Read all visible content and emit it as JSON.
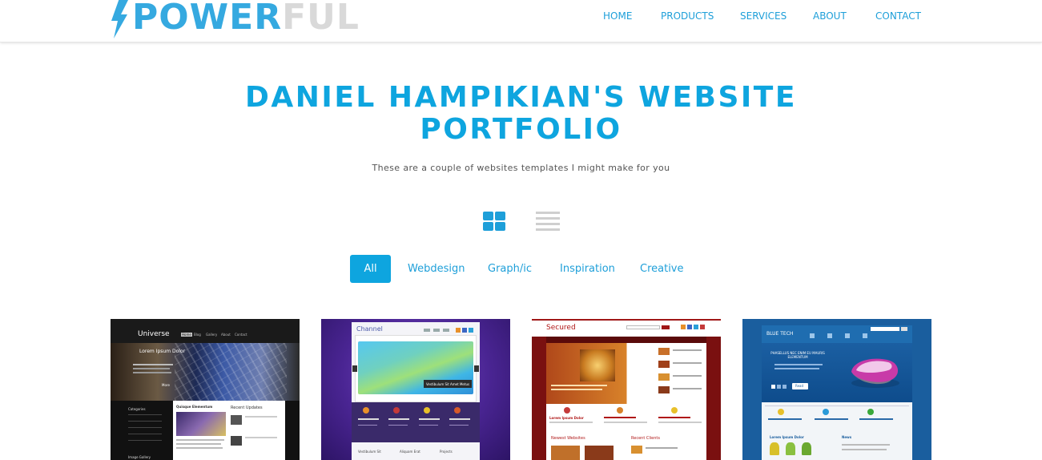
{
  "header": {
    "logo": {
      "part1": "POWER",
      "part2": "FUL",
      "icon": "lightning-bolt-icon"
    },
    "nav": [
      "HOME",
      "PRODUCTS",
      "SERVICES",
      "ABOUT",
      "CONTACT"
    ]
  },
  "hero": {
    "title_line1": "DANIEL HAMPIKIAN'S WEBSITE",
    "title_line2": "PORTFOLIO",
    "subtitle": "These are a couple of websites templates I might make for you"
  },
  "view_toggle": {
    "grid_icon": "grid-view-icon",
    "list_icon": "list-view-icon"
  },
  "filters": [
    "All",
    "Webdesign",
    "Graph/ic",
    "Inspiration",
    "Creative"
  ],
  "active_filter": "All",
  "portfolio": [
    {
      "brand": "Universe",
      "nav": [
        "Home",
        "Blog",
        "Gallery",
        "About",
        "Contact"
      ],
      "hero": "Lorem Ipsum Dolor",
      "more": "More",
      "side": [
        "Categories",
        "Image Gallery"
      ],
      "col1": "Quisque Elementum",
      "col2": "Recent Updates"
    },
    {
      "brand": "Channel",
      "slider_caption": "Vestibulum Sit Amet Metus",
      "sections": [
        "Vestibulum Sit",
        "Aliquam Erat",
        "Projects"
      ]
    },
    {
      "brand": "Secured",
      "feature_head": "Lorem Ipsum Dolor",
      "sections": [
        "Newest Websites",
        "Recent Clients"
      ]
    },
    {
      "brand": "BLUE TECH",
      "hero_text": "PHASELLUS NEC ENIM EU MAURIS ELEMENTUM",
      "button": "Read",
      "sections": [
        "Lorem Ipsum Dolor",
        "News"
      ]
    }
  ],
  "colors": {
    "accent": "#0ea5df",
    "link": "#1e9fd9",
    "muted": "#d9d9d9"
  }
}
